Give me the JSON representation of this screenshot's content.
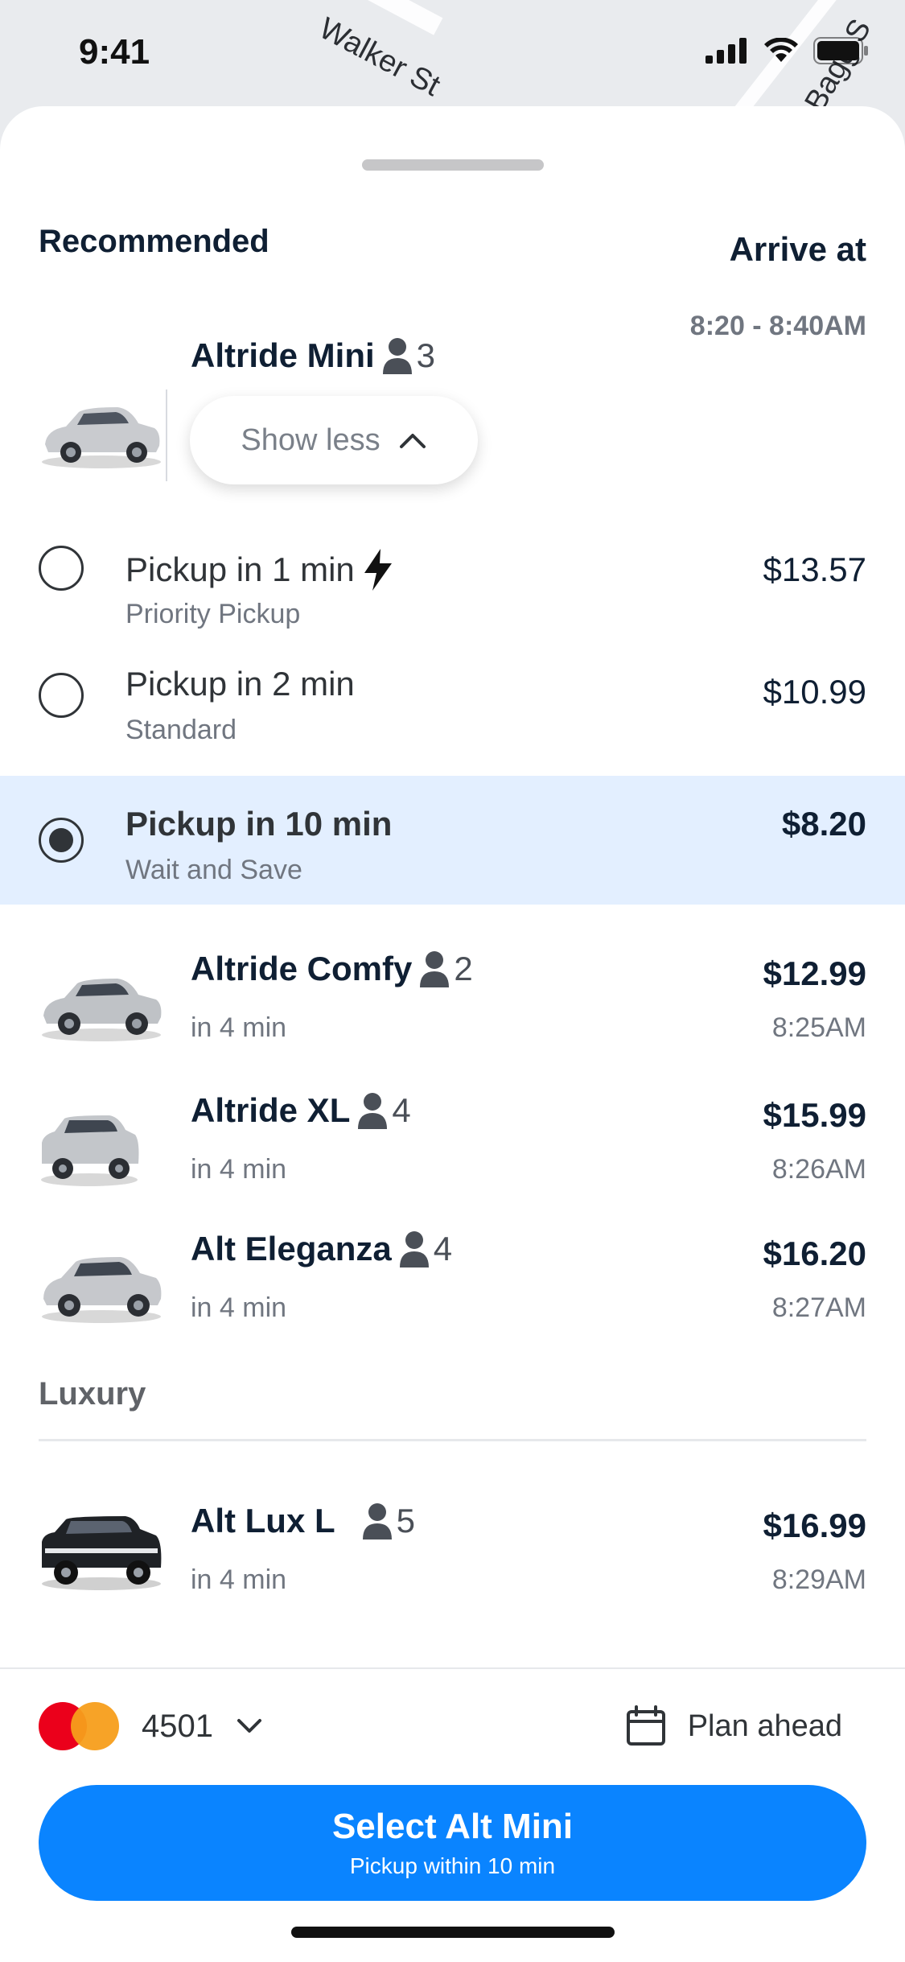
{
  "status_bar": {
    "time": "9:41"
  },
  "map": {
    "street_1": "Walker St",
    "street_2": "Bagg S"
  },
  "recommended": {
    "title": "Recommended",
    "primary": {
      "name": "Altride Mini",
      "passengers": "3",
      "arrive_label": "Arrive at",
      "arrive_window": "8:20 - 8:40AM",
      "toggle_label": "Show less",
      "options": [
        {
          "title": "Pickup in 1 min",
          "subtitle": "Priority Pickup",
          "price": "$13.57",
          "selected": false
        },
        {
          "title": "Pickup in 2 min",
          "subtitle": "Standard",
          "price": "$10.99",
          "selected": false
        },
        {
          "title": "Pickup in 10 min",
          "subtitle": "Wait and Save",
          "price": "$8.20",
          "selected": true
        }
      ]
    },
    "rides": [
      {
        "name": "Altride Comfy",
        "passengers": "2",
        "eta": "in 4 min",
        "price": "$12.99",
        "arrival": "8:25AM"
      },
      {
        "name": "Altride XL",
        "passengers": "4",
        "eta": "in 4 min",
        "price": "$15.99",
        "arrival": "8:26AM"
      },
      {
        "name": "Alt Eleganza",
        "passengers": "4",
        "eta": "in 4 min",
        "price": "$16.20",
        "arrival": "8:27AM"
      }
    ]
  },
  "luxury": {
    "title": "Luxury",
    "rides": [
      {
        "name": "Alt Lux L",
        "passengers": "5",
        "eta": "in 4 min",
        "price": "$16.99",
        "arrival": "8:29AM"
      }
    ]
  },
  "footer": {
    "card_last4": "4501",
    "plan_ahead": "Plan ahead",
    "cta_title": "Select Alt Mini",
    "cta_subtitle": "Pickup within 10 min"
  },
  "colors": {
    "accent": "#0a84ff",
    "selected_bg": "#e3efff"
  }
}
